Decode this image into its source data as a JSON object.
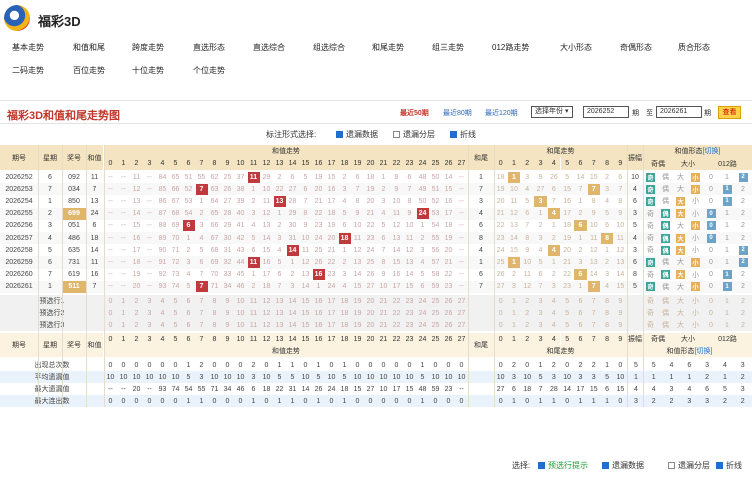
{
  "app": {
    "title": "福彩3D",
    "logo": "fucai-3d-logo-icon"
  },
  "nav": {
    "row1": [
      "基本走势",
      "和值和尾",
      "跨度走势",
      "直选形态",
      "直选综合",
      "组选综合",
      "和尾走势",
      "组三走势",
      "012路走势",
      "大小形态",
      "奇偶形态",
      "质合形态"
    ],
    "row2": [
      "二码走势",
      "百位走势",
      "十位走势",
      "个位走势"
    ]
  },
  "chart_bar": {
    "title": "福彩3D和值和尾走势图",
    "range_links": [
      "最近50期",
      "最近80期",
      "最近120期"
    ],
    "select_label": "选择年份",
    "from_issue": "2026252",
    "issue_label": "期",
    "to_label": "至",
    "to_issue": "2026261",
    "query": "查看",
    "accent": "#c0392b"
  },
  "marks": {
    "label": "标注形式选择:",
    "options": [
      {
        "label": "遗漏数据",
        "checked": true
      },
      {
        "label": "遗漏分层",
        "checked": false
      },
      {
        "label": "折线",
        "checked": true
      }
    ]
  },
  "table": {
    "head": {
      "issue": "期号",
      "week": "星期",
      "win": "奖号",
      "sum": "和值",
      "sum_trend": "和值走势",
      "tail": "和尾",
      "tail_trend": "和尾走势",
      "span": "振幅",
      "form": "和值形态",
      "switch": "切换",
      "oe": "奇偶",
      "bs": "大小",
      "r012": "012路"
    },
    "sum_nums": [
      "0",
      "1",
      "2",
      "3",
      "4",
      "5",
      "6",
      "7",
      "8",
      "9",
      "10",
      "11",
      "12",
      "13",
      "14",
      "15",
      "16",
      "17",
      "18",
      "19",
      "20",
      "21",
      "22",
      "23",
      "24",
      "25",
      "26",
      "27"
    ],
    "tail_nums": [
      "0",
      "1",
      "2",
      "3",
      "4",
      "5",
      "6",
      "7",
      "8",
      "9"
    ],
    "rows": [
      {
        "issue": "2026252",
        "week": "6",
        "win": "092",
        "sum": "11",
        "tail": "1",
        "span": "10",
        "oe": "奇",
        "bs": "小",
        "r012": "2",
        "sum_cells": [
          "--",
          "--",
          "11",
          "--",
          "84",
          "65",
          "51",
          "55",
          "62",
          "25",
          "37",
          "11",
          "29",
          "2",
          "6",
          "5",
          "19",
          "15",
          "2",
          "6",
          "18",
          "1",
          "8",
          "6",
          "48",
          "50",
          "14",
          "--"
        ],
        "tail_cells": [
          "18",
          "1",
          "3",
          "9",
          "26",
          "5",
          "14",
          "15",
          "2",
          "6"
        ]
      },
      {
        "issue": "2026253",
        "week": "7",
        "win": "034",
        "sum": "7",
        "tail": "7",
        "span": "4",
        "oe": "奇",
        "bs": "小",
        "r012": "1",
        "sum_cells": [
          "--",
          "--",
          "12",
          "--",
          "85",
          "66",
          "52",
          "7",
          "63",
          "26",
          "38",
          "1",
          "10",
          "22",
          "27",
          "6",
          "20",
          "16",
          "3",
          "7",
          "19",
          "2",
          "9",
          "7",
          "49",
          "51",
          "15",
          "--"
        ],
        "tail_cells": [
          "19",
          "10",
          "4",
          "27",
          "6",
          "15",
          "7",
          "7",
          "3",
          "7"
        ]
      },
      {
        "issue": "2026254",
        "week": "1",
        "win": "850",
        "sum": "13",
        "tail": "3",
        "span": "6",
        "oe": "奇",
        "bs": "大",
        "r012": "1",
        "sum_cells": [
          "--",
          "--",
          "13",
          "--",
          "86",
          "67",
          "53",
          "1",
          "64",
          "27",
          "39",
          "2",
          "11",
          "13",
          "28",
          "7",
          "21",
          "17",
          "4",
          "8",
          "20",
          "3",
          "10",
          "8",
          "50",
          "52",
          "16",
          "--"
        ],
        "tail_cells": [
          "20",
          "11",
          "5",
          "3",
          "7",
          "16",
          "1",
          "8",
          "4",
          "8"
        ]
      },
      {
        "issue": "2026255",
        "week": "2",
        "win": "699",
        "sum": "24",
        "tail": "4",
        "span": "3",
        "oe": "偶",
        "bs": "大",
        "r012": "0",
        "sum_cells": [
          "--",
          "--",
          "14",
          "--",
          "87",
          "68",
          "54",
          "2",
          "65",
          "28",
          "40",
          "3",
          "12",
          "1",
          "29",
          "8",
          "22",
          "18",
          "5",
          "9",
          "21",
          "4",
          "11",
          "9",
          "24",
          "53",
          "17",
          "--"
        ],
        "tail_cells": [
          "21",
          "12",
          "6",
          "1",
          "4",
          "17",
          "2",
          "9",
          "5",
          "9"
        ]
      },
      {
        "issue": "2026256",
        "week": "3",
        "win": "051",
        "sum": "6",
        "tail": "6",
        "span": "5",
        "oe": "偶",
        "bs": "小",
        "r012": "0",
        "sum_cells": [
          "--",
          "--",
          "15",
          "--",
          "88",
          "69",
          "6",
          "3",
          "66",
          "29",
          "41",
          "4",
          "13",
          "2",
          "30",
          "9",
          "23",
          "19",
          "6",
          "10",
          "22",
          "5",
          "12",
          "10",
          "1",
          "54",
          "18",
          "--"
        ],
        "tail_cells": [
          "22",
          "13",
          "7",
          "2",
          "1",
          "18",
          "6",
          "10",
          "6",
          "10"
        ]
      },
      {
        "issue": "2026257",
        "week": "4",
        "win": "486",
        "sum": "18",
        "tail": "8",
        "span": "4",
        "oe": "偶",
        "bs": "大",
        "r012": "0",
        "sum_cells": [
          "--",
          "--",
          "16",
          "--",
          "89",
          "70",
          "1",
          "4",
          "67",
          "30",
          "42",
          "5",
          "14",
          "3",
          "31",
          "10",
          "24",
          "20",
          "18",
          "11",
          "23",
          "6",
          "13",
          "11",
          "2",
          "55",
          "19",
          "--"
        ],
        "tail_cells": [
          "23",
          "14",
          "8",
          "3",
          "2",
          "19",
          "1",
          "11",
          "8",
          "11"
        ]
      },
      {
        "issue": "2026258",
        "week": "5",
        "win": "635",
        "sum": "14",
        "tail": "4",
        "span": "3",
        "oe": "偶",
        "bs": "大",
        "r012": "2",
        "sum_cells": [
          "--",
          "--",
          "17",
          "--",
          "90",
          "71",
          "2",
          "5",
          "68",
          "31",
          "43",
          "6",
          "15",
          "4",
          "14",
          "11",
          "25",
          "21",
          "1",
          "12",
          "24",
          "7",
          "14",
          "12",
          "3",
          "56",
          "20",
          "--"
        ],
        "tail_cells": [
          "24",
          "15",
          "9",
          "4",
          "4",
          "20",
          "2",
          "12",
          "1",
          "12"
        ]
      },
      {
        "issue": "2026259",
        "week": "6",
        "win": "731",
        "sum": "11",
        "tail": "1",
        "span": "6",
        "oe": "奇",
        "bs": "小",
        "r012": "2",
        "sum_cells": [
          "--",
          "--",
          "18",
          "--",
          "91",
          "72",
          "3",
          "6",
          "69",
          "32",
          "44",
          "11",
          "16",
          "5",
          "1",
          "12",
          "26",
          "22",
          "2",
          "13",
          "25",
          "8",
          "15",
          "13",
          "4",
          "57",
          "21",
          "--"
        ],
        "tail_cells": [
          "25",
          "1",
          "10",
          "5",
          "1",
          "21",
          "3",
          "13",
          "2",
          "13"
        ]
      },
      {
        "issue": "2026260",
        "week": "7",
        "win": "619",
        "sum": "16",
        "tail": "6",
        "span": "8",
        "oe": "偶",
        "bs": "大",
        "r012": "1",
        "sum_cells": [
          "--",
          "--",
          "19",
          "--",
          "92",
          "73",
          "4",
          "7",
          "70",
          "33",
          "45",
          "1",
          "17",
          "6",
          "2",
          "13",
          "16",
          "23",
          "3",
          "14",
          "26",
          "9",
          "16",
          "14",
          "5",
          "58",
          "22",
          "--"
        ],
        "tail_cells": [
          "26",
          "2",
          "11",
          "6",
          "2",
          "22",
          "6",
          "14",
          "3",
          "14"
        ]
      },
      {
        "issue": "2026261",
        "week": "1",
        "win": "511",
        "sum": "7",
        "tail": "7",
        "span": "5",
        "oe": "奇",
        "bs": "小",
        "r012": "1",
        "sum_cells": [
          "--",
          "--",
          "20",
          "--",
          "93",
          "74",
          "5",
          "7",
          "71",
          "34",
          "46",
          "2",
          "18",
          "7",
          "3",
          "14",
          "1",
          "24",
          "4",
          "15",
          "27",
          "10",
          "17",
          "15",
          "6",
          "59",
          "23",
          "--"
        ],
        "tail_cells": [
          "27",
          "3",
          "12",
          "7",
          "3",
          "23",
          "1",
          "7",
          "4",
          "15"
        ]
      }
    ],
    "preselect": [
      "预选行1",
      "预选行2",
      "预选行3"
    ],
    "stats": [
      {
        "label": "出现总次数",
        "sum_cells": [
          "0",
          "0",
          "0",
          "0",
          "0",
          "0",
          "1",
          "2",
          "0",
          "0",
          "0",
          "2",
          "0",
          "1",
          "1",
          "0",
          "1",
          "0",
          "1",
          "0",
          "0",
          "0",
          "0",
          "0",
          "1",
          "0",
          "0",
          "0"
        ],
        "tail_cells": [
          "0",
          "2",
          "0",
          "1",
          "2",
          "0",
          "2",
          "2",
          "1",
          "0"
        ],
        "extra": [
          "5",
          "5",
          "4",
          "6",
          "3",
          "4",
          "3"
        ]
      },
      {
        "label": "平均遗漏值",
        "sum_cells": [
          "10",
          "10",
          "10",
          "10",
          "10",
          "10",
          "5",
          "3",
          "10",
          "10",
          "10",
          "3",
          "10",
          "5",
          "5",
          "10",
          "5",
          "10",
          "5",
          "10",
          "10",
          "10",
          "10",
          "10",
          "5",
          "10",
          "10",
          "10"
        ],
        "tail_cells": [
          "10",
          "3",
          "10",
          "5",
          "3",
          "10",
          "3",
          "3",
          "5",
          "10"
        ],
        "extra": [
          "1",
          "1",
          "1",
          "1",
          "2",
          "1",
          "2"
        ]
      },
      {
        "label": "最大遗漏值",
        "sum_cells": [
          "--",
          "--",
          "20",
          "--",
          "93",
          "74",
          "54",
          "55",
          "71",
          "34",
          "46",
          "6",
          "18",
          "22",
          "31",
          "14",
          "26",
          "24",
          "18",
          "15",
          "27",
          "10",
          "17",
          "15",
          "48",
          "59",
          "23",
          "--"
        ],
        "tail_cells": [
          "27",
          "6",
          "18",
          "7",
          "28",
          "14",
          "17",
          "15",
          "6",
          "15"
        ],
        "extra": [
          "4",
          "4",
          "3",
          "4",
          "6",
          "5",
          "3"
        ]
      },
      {
        "label": "最大连出数",
        "sum_cells": [
          "0",
          "0",
          "0",
          "0",
          "0",
          "0",
          "1",
          "1",
          "0",
          "0",
          "0",
          "1",
          "0",
          "1",
          "1",
          "0",
          "1",
          "0",
          "1",
          "0",
          "0",
          "0",
          "0",
          "0",
          "1",
          "0",
          "0",
          "0"
        ],
        "tail_cells": [
          "0",
          "1",
          "0",
          "1",
          "1",
          "0",
          "1",
          "1",
          "1",
          "0"
        ],
        "extra": [
          "3",
          "2",
          "2",
          "3",
          "3",
          "2",
          "2"
        ]
      }
    ]
  },
  "bottom": {
    "label": "选择:",
    "options": [
      {
        "label": "预选行提示",
        "checked": true,
        "green": true
      },
      {
        "label": "遗漏数据",
        "checked": true
      },
      {
        "label": "遗漏分层",
        "checked": false
      },
      {
        "label": "折线",
        "checked": true
      }
    ]
  }
}
